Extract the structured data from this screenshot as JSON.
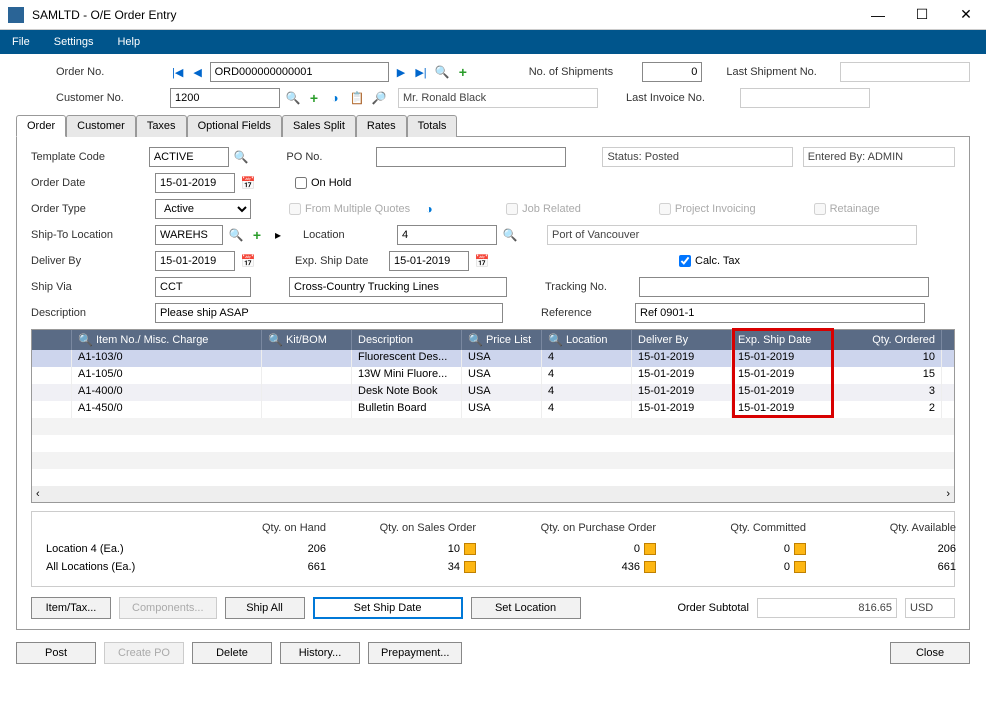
{
  "window": {
    "title": "SAMLTD - O/E Order Entry"
  },
  "menu": {
    "file": "File",
    "settings": "Settings",
    "help": "Help"
  },
  "header": {
    "order_no_label": "Order No.",
    "order_no": "ORD000000000001",
    "num_shipments_label": "No. of Shipments",
    "num_shipments": "0",
    "last_shipment_label": "Last Shipment No.",
    "last_shipment": "",
    "customer_no_label": "Customer No.",
    "customer_no": "1200",
    "customer_name": "Mr. Ronald Black",
    "last_invoice_label": "Last Invoice No.",
    "last_invoice": ""
  },
  "tabs": [
    "Order",
    "Customer",
    "Taxes",
    "Optional Fields",
    "Sales Split",
    "Rates",
    "Totals"
  ],
  "order": {
    "template_code_label": "Template Code",
    "template_code": "ACTIVE",
    "po_no_label": "PO No.",
    "po_no": "",
    "status_label": "Status: Posted",
    "entered_by_label": "Entered By: ADMIN",
    "order_date_label": "Order Date",
    "order_date": "15-01-2019",
    "on_hold_label": "On Hold",
    "order_type_label": "Order Type",
    "order_type": "Active",
    "multi_quotes_label": "From Multiple Quotes",
    "job_related_label": "Job Related",
    "project_inv_label": "Project Invoicing",
    "retainage_label": "Retainage",
    "ship_to_label": "Ship-To Location",
    "ship_to": "WAREHS",
    "location_label": "Location",
    "location": "4",
    "location_desc": "Port of Vancouver",
    "deliver_by_label": "Deliver By",
    "deliver_by": "15-01-2019",
    "exp_ship_label": "Exp. Ship Date",
    "exp_ship": "15-01-2019",
    "calc_tax_label": "Calc. Tax",
    "ship_via_label": "Ship Via",
    "ship_via": "CCT",
    "ship_via_desc": "Cross-Country Trucking Lines",
    "tracking_label": "Tracking No.",
    "tracking": "",
    "description_label": "Description",
    "description": "Please ship ASAP",
    "reference_label": "Reference",
    "reference": "Ref 0901-1"
  },
  "grid": {
    "headers": {
      "item": "Item No./ Misc. Charge",
      "kit": "Kit/BOM",
      "desc": "Description",
      "price": "Price List",
      "loc": "Location",
      "deliver": "Deliver By",
      "exp": "Exp. Ship Date",
      "qty": "Qty. Ordered"
    },
    "rows": [
      {
        "item": "A1-103/0",
        "kit": "",
        "desc": "Fluorescent Des...",
        "price": "USA",
        "loc": "4",
        "deliver": "15-01-2019",
        "exp": "15-01-2019",
        "qty": "10"
      },
      {
        "item": "A1-105/0",
        "kit": "",
        "desc": "13W Mini Fluore...",
        "price": "USA",
        "loc": "4",
        "deliver": "15-01-2019",
        "exp": "15-01-2019",
        "qty": "15"
      },
      {
        "item": "A1-400/0",
        "kit": "",
        "desc": "Desk Note Book",
        "price": "USA",
        "loc": "4",
        "deliver": "15-01-2019",
        "exp": "15-01-2019",
        "qty": "3"
      },
      {
        "item": "A1-450/0",
        "kit": "",
        "desc": "Bulletin Board",
        "price": "USA",
        "loc": "4",
        "deliver": "15-01-2019",
        "exp": "15-01-2019",
        "qty": "2"
      }
    ]
  },
  "qty": {
    "on_hand_label": "Qty. on Hand",
    "on_so_label": "Qty. on Sales Order",
    "on_po_label": "Qty. on Purchase Order",
    "committed_label": "Qty. Committed",
    "available_label": "Qty. Available",
    "loc4_label": "Location  4 (Ea.)",
    "all_loc_label": "All Locations (Ea.)",
    "loc4": {
      "on_hand": "206",
      "on_so": "10",
      "on_po": "0",
      "committed": "0",
      "available": "206"
    },
    "all": {
      "on_hand": "661",
      "on_so": "34",
      "on_po": "436",
      "committed": "0",
      "available": "661"
    }
  },
  "buttons": {
    "item_tax": "Item/Tax...",
    "components": "Components...",
    "ship_all": "Ship All",
    "set_ship": "Set Ship Date",
    "set_loc": "Set Location",
    "subtotal_label": "Order Subtotal",
    "subtotal": "816.65",
    "currency": "USD",
    "post": "Post",
    "create_po": "Create PO",
    "delete": "Delete",
    "history": "History...",
    "prepayment": "Prepayment...",
    "close": "Close"
  }
}
